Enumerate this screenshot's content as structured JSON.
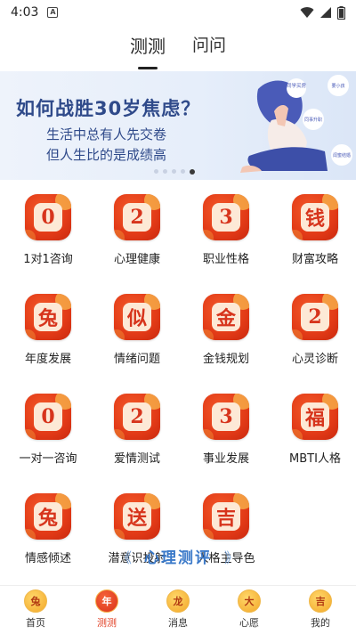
{
  "status": {
    "time": "4:03",
    "notif_glyph": "A"
  },
  "top_tabs": [
    {
      "label": "测测",
      "active": true
    },
    {
      "label": "问问",
      "active": false
    }
  ],
  "banner": {
    "title": "如何战胜30岁焦虑？",
    "subtitle_line1": "生活中总有人先交卷",
    "subtitle_line2": "但人生比的是成绩高",
    "bubbles": [
      "同学买房",
      "要小孩",
      "同事升职",
      "闺蜜结婚"
    ],
    "active_dot_index": 4
  },
  "grid": [
    {
      "glyph": "0",
      "label": "1对1咨询"
    },
    {
      "glyph": "2",
      "label": "心理健康"
    },
    {
      "glyph": "3",
      "label": "职业性格"
    },
    {
      "glyph": "钱",
      "label": "财富攻略"
    },
    {
      "glyph": "兔",
      "label": "年度发展"
    },
    {
      "glyph": "似",
      "label": "情绪问题"
    },
    {
      "glyph": "金",
      "label": "金钱规划"
    },
    {
      "glyph": "2",
      "label": "心灵诊断"
    },
    {
      "glyph": "0",
      "label": "一对一咨询"
    },
    {
      "glyph": "2",
      "label": "爱情测试"
    },
    {
      "glyph": "3",
      "label": "事业发展"
    },
    {
      "glyph": "福",
      "label": "MBTI人格"
    },
    {
      "glyph": "兔",
      "label": "情感倾述"
    },
    {
      "glyph": "送",
      "label": "潜意识投射"
    },
    {
      "glyph": "吉",
      "label": "人格主导色"
    }
  ],
  "section": {
    "title": "心理测评",
    "left_chevron": "《",
    "right_chevron": "》"
  },
  "bottom_nav": [
    {
      "glyph": "兔",
      "label": "首页",
      "active": false
    },
    {
      "glyph": "年",
      "label": "测测",
      "active": true
    },
    {
      "glyph": "龙",
      "label": "消息",
      "active": false
    },
    {
      "glyph": "大",
      "label": "心愿",
      "active": false
    },
    {
      "glyph": "吉",
      "label": "我的",
      "active": false
    }
  ],
  "colors": {
    "accent": "#e23a17",
    "banner_text": "#2f4a8a",
    "section_blue": "#3a79c9"
  }
}
